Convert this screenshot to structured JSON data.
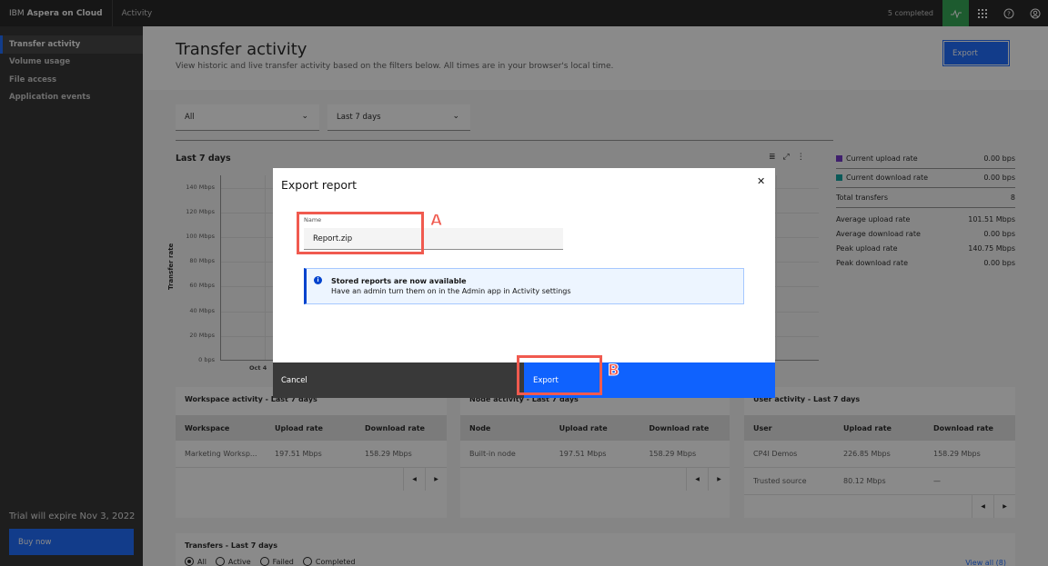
{
  "header": {
    "brand_prefix": "IBM",
    "brand_name": "Aspera on Cloud",
    "app_name": "Activity",
    "status_text": "5 completed",
    "icons": [
      "activity-pulse-icon",
      "app-switcher-grid-icon",
      "help-icon",
      "user-avatar-icon"
    ]
  },
  "sidebar": {
    "items": [
      {
        "label": "Transfer activity",
        "active": true
      },
      {
        "label": "Volume usage",
        "active": false
      },
      {
        "label": "File access",
        "active": false
      },
      {
        "label": "Application events",
        "active": false
      }
    ],
    "trial_text": "Trial will expire Nov 3, 2022",
    "buy_label": "Buy now"
  },
  "page": {
    "title": "Transfer activity",
    "subtitle": "View historic and live transfer activity based on the filters below. All times are in your browser's local time.",
    "export_label": "Export"
  },
  "filters": {
    "scope": {
      "selected": "All"
    },
    "range": {
      "selected": "Last 7 days"
    }
  },
  "chart": {
    "title": "Last 7 days",
    "y_axis_title": "Transfer rate",
    "y_ticks": [
      "140 Mbps",
      "120 Mbps",
      "100 Mbps",
      "80 Mbps",
      "60 Mbps",
      "40 Mbps",
      "20 Mbps",
      "0 bps"
    ],
    "x_ticks": [
      "Oct 4"
    ],
    "tools": [
      "table-view-icon",
      "maximize-icon",
      "overflow-menu-icon"
    ]
  },
  "chart_data": {
    "type": "line",
    "title": "Last 7 days",
    "xlabel": "",
    "ylabel": "Transfer rate",
    "x": [
      "Oct 4"
    ],
    "y_tick_labels": [
      "0 bps",
      "20 Mbps",
      "40 Mbps",
      "60 Mbps",
      "80 Mbps",
      "100 Mbps",
      "120 Mbps",
      "140 Mbps"
    ],
    "ylim": [
      0,
      150
    ],
    "grid": true,
    "series": [
      {
        "name": "Current upload rate",
        "color": "#6929c4",
        "values": []
      },
      {
        "name": "Current download rate",
        "color": "#009d9a",
        "values": []
      }
    ]
  },
  "stats": {
    "current_upload": {
      "label": "Current upload rate",
      "value": "0.00 bps",
      "color": "#6929c4"
    },
    "current_download": {
      "label": "Current download rate",
      "value": "0.00 bps",
      "color": "#009d9a"
    },
    "total_transfers": {
      "label": "Total transfers",
      "value": "8"
    },
    "avg_upload": {
      "label": "Average upload rate",
      "value": "101.51 Mbps"
    },
    "avg_download": {
      "label": "Average download rate",
      "value": "0.00 bps"
    },
    "peak_upload": {
      "label": "Peak upload rate",
      "value": "140.75 Mbps"
    },
    "peak_download": {
      "label": "Peak download rate",
      "value": "0.00 bps"
    }
  },
  "workspace_card": {
    "title": "Workspace activity - Last 7 days",
    "columns": [
      "Workspace",
      "Upload rate",
      "Download rate"
    ],
    "rows": [
      [
        "Marketing Worksp...",
        "197.51 Mbps",
        "158.29 Mbps"
      ]
    ]
  },
  "node_card": {
    "title": "Node activity - Last 7 days",
    "columns": [
      "Node",
      "Upload rate",
      "Download rate"
    ],
    "rows": [
      [
        "Built-in node",
        "197.51 Mbps",
        "158.29 Mbps"
      ]
    ]
  },
  "user_card": {
    "title": "User activity - Last 7 days",
    "columns": [
      "User",
      "Upload rate",
      "Download rate"
    ],
    "rows": [
      [
        "CP4I Demos",
        "226.85 Mbps",
        "158.29 Mbps"
      ],
      [
        "Trusted source",
        "80.12 Mbps",
        "—"
      ]
    ]
  },
  "transfers": {
    "title": "Transfers - Last 7 days",
    "radios": [
      {
        "label": "All",
        "checked": true
      },
      {
        "label": "Active",
        "checked": false
      },
      {
        "label": "Failed",
        "checked": false
      },
      {
        "label": "Completed",
        "checked": false
      }
    ],
    "view_all": "View all (8)"
  },
  "modal": {
    "title": "Export report",
    "name_label": "Name",
    "name_value": "Report.zip",
    "notice_title": "Stored reports are now available",
    "notice_body": "Have an admin turn them on in the Admin app in Activity settings",
    "cancel_label": "Cancel",
    "export_label": "Export"
  },
  "annotations": {
    "a": "A",
    "b": "B",
    "color": "#f05a4f"
  }
}
